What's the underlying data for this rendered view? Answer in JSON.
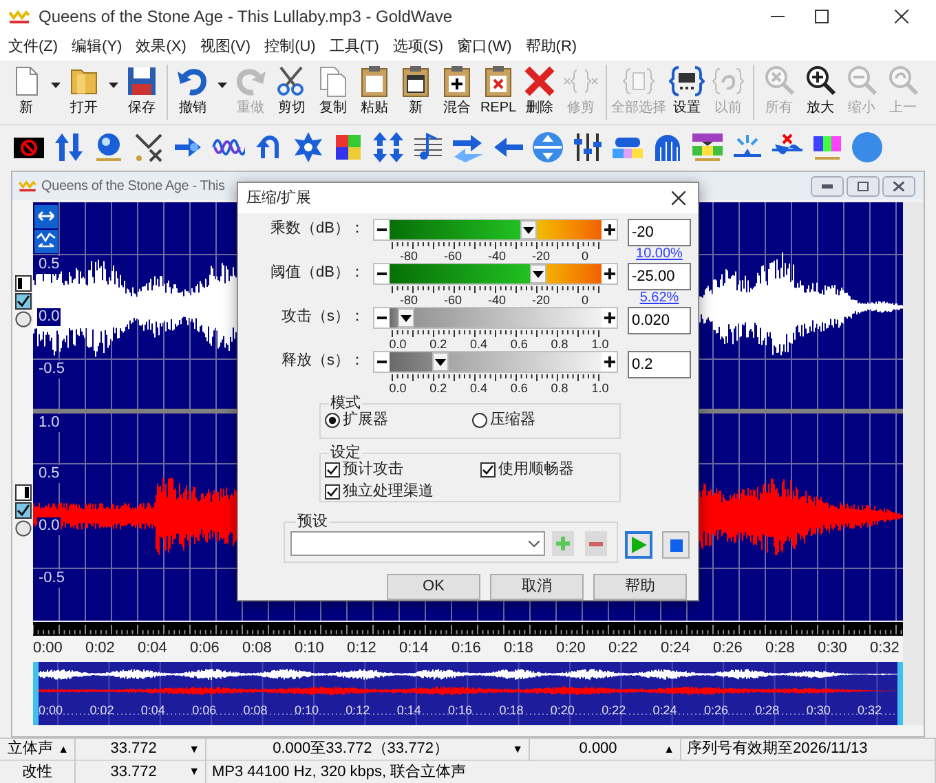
{
  "window": {
    "title": "Queens of the Stone Age - This Lullaby.mp3 - GoldWave"
  },
  "menu": [
    "文件(Z)",
    "编辑(Y)",
    "效果(X)",
    "视图(V)",
    "控制(U)",
    "工具(T)",
    "选项(S)",
    "窗口(W)",
    "帮助(R)"
  ],
  "toolbar": [
    [
      {
        "label": "新",
        "kind": "new",
        "dropdown": true,
        "disabled": false
      },
      {
        "label": "打开",
        "kind": "open",
        "dropdown": true,
        "disabled": false
      },
      {
        "label": "保存",
        "kind": "save",
        "dropdown": false,
        "disabled": false
      }
    ],
    [
      {
        "label": "撤销",
        "kind": "undo",
        "dropdown": true,
        "disabled": false
      },
      {
        "label": "重做",
        "kind": "redo",
        "dropdown": false,
        "disabled": true
      },
      {
        "label": "剪切",
        "kind": "cut",
        "dropdown": false,
        "disabled": false
      },
      {
        "label": "复制",
        "kind": "copy",
        "dropdown": false,
        "disabled": false
      },
      {
        "label": "粘贴",
        "kind": "paste",
        "dropdown": false,
        "disabled": false
      },
      {
        "label": "新",
        "kind": "paste-new",
        "dropdown": false,
        "disabled": false
      },
      {
        "label": "混合",
        "kind": "mix",
        "dropdown": false,
        "disabled": false
      },
      {
        "label": "REPL",
        "kind": "replace",
        "dropdown": false,
        "disabled": false
      },
      {
        "label": "删除",
        "kind": "delete",
        "dropdown": false,
        "disabled": false
      },
      {
        "label": "修剪",
        "kind": "trim",
        "dropdown": false,
        "disabled": true
      }
    ],
    [
      {
        "label": "全部选择",
        "kind": "select-all",
        "dropdown": false,
        "disabled": true
      },
      {
        "label": "设置",
        "kind": "set",
        "dropdown": false,
        "disabled": false
      },
      {
        "label": "以前",
        "kind": "previous",
        "dropdown": false,
        "disabled": true
      }
    ],
    [
      {
        "label": "所有",
        "kind": "zoom-all",
        "dropdown": false,
        "disabled": true
      },
      {
        "label": "放大",
        "kind": "zoom-in",
        "dropdown": false,
        "disabled": false
      },
      {
        "label": "缩小",
        "kind": "zoom-out",
        "dropdown": false,
        "disabled": true
      },
      {
        "label": "上一",
        "kind": "zoom-previous",
        "dropdown": false,
        "disabled": true
      }
    ]
  ],
  "document": {
    "title": "Queens of the Stone Age - This",
    "channels": [
      {
        "color": "#ffffff",
        "checked": true,
        "scale": [
          "0.5",
          "0.0",
          "-0.5"
        ]
      },
      {
        "color": "#ff0000",
        "checked": true,
        "scale": [
          "1.0",
          "0.5",
          "0.0",
          "-0.5"
        ]
      }
    ],
    "timeline": [
      "0:00",
      "0:02",
      "0:04",
      "0:06",
      "0:08",
      "0:10",
      "0:12",
      "0:14",
      "0:16",
      "0:18",
      "0:20",
      "0:22",
      "0:24",
      "0:26",
      "0:28",
      "0:30",
      "0:32"
    ],
    "overview_timeline": [
      "0:00",
      "0:02",
      "0:04",
      "0:06",
      "0:08",
      "0:10",
      "0:12",
      "0:14",
      "0:16",
      "0:18",
      "0:20",
      "0:22",
      "0:24",
      "0:26",
      "0:28",
      "0:30",
      "0:32"
    ]
  },
  "dialog": {
    "title": "压缩/扩展",
    "sliders": [
      {
        "label": "乘数（dB）：",
        "kind": "db",
        "level": 0.67,
        "ticks": [
          "-80",
          "-60",
          "-40",
          "-20",
          "0"
        ],
        "value": "-20",
        "link": "10.00%"
      },
      {
        "label": "阈值（dB）：",
        "kind": "db",
        "level": 0.72,
        "ticks": [
          "-80",
          "-60",
          "-40",
          "-20",
          "0"
        ],
        "value": "-25.00",
        "link": "5.62%"
      },
      {
        "label": "攻击（s）：",
        "kind": "time",
        "level": 0.04,
        "ticks": [
          "0.0",
          "0.2",
          "0.4",
          "0.6",
          "0.8",
          "1.0"
        ],
        "value": "0.020"
      },
      {
        "label": "释放（s）：",
        "kind": "time",
        "level": 0.22,
        "ticks": [
          "0.0",
          "0.2",
          "0.4",
          "0.6",
          "0.8",
          "1.0"
        ],
        "value": "0.2"
      }
    ],
    "mode": {
      "legend": "模式",
      "options": [
        {
          "label": "扩展器",
          "selected": true
        },
        {
          "label": "压缩器",
          "selected": false
        }
      ]
    },
    "settings": {
      "legend": "设定",
      "options": [
        {
          "label": "预计攻击",
          "checked": true
        },
        {
          "label": "使用顺畅器",
          "checked": true
        },
        {
          "label": "独立处理渠道",
          "checked": true
        }
      ]
    },
    "preset": {
      "legend": "预设"
    },
    "buttons": [
      "OK",
      "取消",
      "帮助"
    ]
  },
  "status_bar": {
    "rows": [
      [
        {
          "text": "立体声",
          "arrow": "▲"
        },
        {
          "text": "33.772",
          "arrow": "▼"
        },
        {
          "text": "0.000至33.772（33.772）",
          "arrow": "▼"
        },
        {
          "text": "0.000",
          "arrow": "▲"
        },
        {
          "text": "序列号有效期至2026/11/13"
        }
      ],
      [
        {
          "text": "改性"
        },
        {
          "text": "33.772",
          "arrow": "▼"
        },
        {
          "text": "MP3 44100 Hz, 320 kbps, 联合立体声"
        }
      ]
    ]
  }
}
